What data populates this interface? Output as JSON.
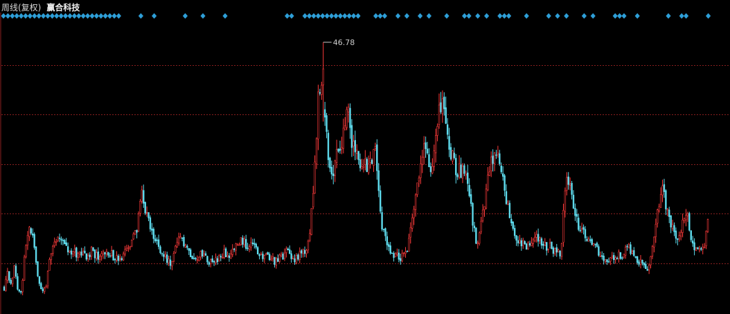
{
  "header": {
    "period_label": "周线(复权)",
    "stock_name": "赢合科技"
  },
  "colors": {
    "background": "#000000",
    "up": "#ff3b3b",
    "down": "#5fdcee",
    "grid": "#8a1f1f",
    "axis": "#8a1f1f",
    "marker": "#2e9fd8",
    "label": "#cccccc"
  },
  "chart_data": {
    "type": "candlestick",
    "title": "赢合科技",
    "period": "周线(复权)",
    "grid": true,
    "max_price_label": "46.78",
    "ylim": [
      6,
      50
    ],
    "y_gridlines": [
      13.63,
      21.05,
      28.48,
      35.91,
      43.33
    ],
    "trend_closes": [
      10.0,
      12.0,
      10.5,
      13.5,
      9.5,
      9.0,
      16.0,
      19.0,
      18.0,
      14.0,
      11.0,
      9.5,
      10.0,
      14.5,
      16.5,
      17.5,
      18.0,
      16.5,
      15.5,
      15.0,
      15.2,
      14.8,
      15.2,
      14.5,
      15.0,
      15.5,
      14.8,
      14.5,
      15.5,
      15.3,
      15.0,
      14.8,
      14.2,
      14.0,
      14.5,
      15.5,
      16.0,
      17.5,
      19.0,
      24.5,
      23.0,
      20.0,
      18.5,
      17.0,
      16.5,
      15.5,
      14.5,
      14.0,
      13.5,
      16.0,
      17.0,
      16.8,
      15.5,
      15.3,
      14.8,
      14.5,
      14.8,
      14.5,
      14.0,
      13.8,
      13.5,
      14.5,
      14.0,
      15.3,
      14.5,
      15.5,
      16.0,
      16.5,
      17.0,
      16.5,
      16.5,
      16.3,
      15.5,
      14.5,
      14.8,
      14.5,
      14.3,
      14.0,
      13.8,
      14.5,
      15.0,
      15.2,
      14.5,
      14.3,
      14.8,
      15.0,
      15.5,
      17.5,
      22.0,
      30.0,
      41.0,
      38.5,
      33.0,
      28.0,
      27.5,
      29.5,
      31.0,
      34.0,
      38.0,
      33.0,
      30.5,
      29.5,
      28.5,
      28.0,
      28.3,
      28.0,
      32.0,
      24.0,
      19.0,
      17.5,
      16.0,
      15.2,
      14.8,
      14.5,
      15.0,
      15.5,
      19.0,
      22.5,
      25.0,
      29.0,
      31.5,
      29.5,
      27.5,
      30.0,
      35.0,
      38.5,
      36.0,
      31.0,
      29.5,
      28.0,
      27.5,
      27.0,
      26.5,
      24.5,
      19.0,
      16.5,
      19.0,
      22.0,
      26.5,
      28.5,
      30.0,
      29.5,
      27.5,
      24.0,
      22.0,
      19.5,
      18.0,
      17.0,
      16.5,
      16.2,
      16.5,
      18.0,
      17.5,
      17.0,
      16.5,
      16.2,
      16.0,
      15.5,
      15.2,
      15.0,
      23.0,
      27.0,
      24.0,
      21.5,
      19.5,
      18.5,
      17.5,
      17.0,
      16.5,
      16.0,
      15.0,
      14.0,
      13.5,
      13.8,
      14.5,
      15.0,
      14.5,
      15.5,
      16.0,
      15.5,
      14.8,
      14.0,
      13.5,
      13.0,
      12.8,
      15.5,
      19.0,
      22.0,
      25.0,
      22.5,
      20.5,
      19.0,
      17.5,
      18.5,
      20.0,
      21.0,
      17.5,
      16.5,
      15.5,
      16.0,
      16.2,
      20.0
    ]
  }
}
